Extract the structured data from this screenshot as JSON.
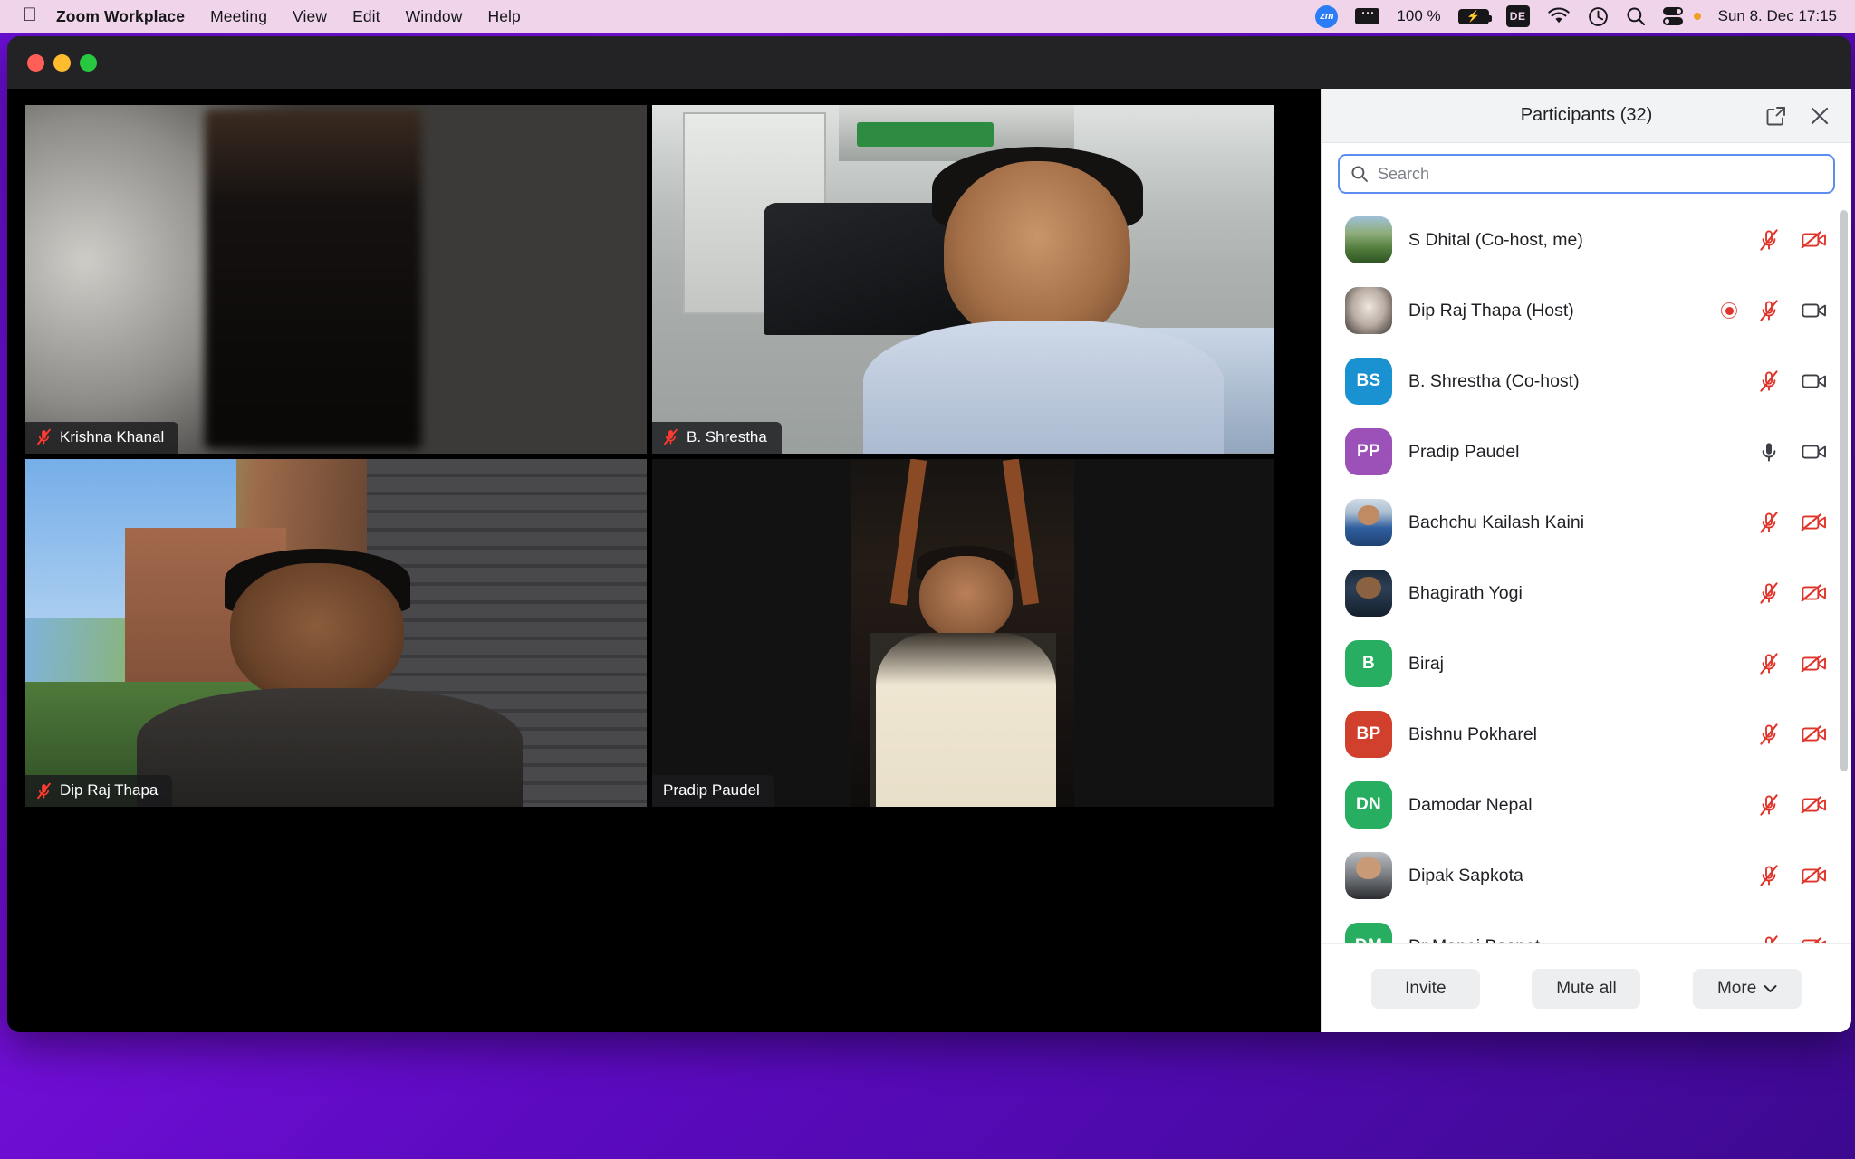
{
  "menubar": {
    "apple_icon": "apple-logo-icon",
    "items": [
      {
        "label": "Zoom Workplace",
        "bold": true
      },
      {
        "label": "Meeting",
        "bold": false
      },
      {
        "label": "View",
        "bold": false
      },
      {
        "label": "Edit",
        "bold": false
      },
      {
        "label": "Window",
        "bold": false
      },
      {
        "label": "Help",
        "bold": false
      }
    ],
    "status": {
      "zoom_badge": "zm",
      "keyboard_icon": "keyboard-icon",
      "battery_percent": "100 %",
      "battery_icon": "battery-charging-icon",
      "input_source": "DE",
      "wifi_icon": "wifi-icon",
      "clock_icon": "time-machine-icon",
      "search_icon": "spotlight-search-icon",
      "control_center_icon": "control-center-icon",
      "datetime": "Sun 8. Dec  17:15"
    }
  },
  "window": {
    "traffic_lights": [
      "close",
      "minimize",
      "maximize"
    ]
  },
  "video_grid": {
    "tiles": [
      {
        "name": "Krishna Khanal",
        "muted": true,
        "active_speaker": false,
        "bg": "bg-krishna"
      },
      {
        "name": "B. Shrestha",
        "muted": true,
        "active_speaker": false,
        "bg": "bg-bshrestha"
      },
      {
        "name": "Dip Raj Thapa",
        "muted": true,
        "active_speaker": false,
        "bg": "bg-dip"
      },
      {
        "name": "Pradip Paudel",
        "muted": false,
        "active_speaker": true,
        "bg": "bg-pradip"
      }
    ]
  },
  "participants_panel": {
    "title": "Participants (32)",
    "count": 32,
    "popout_icon": "popout-window-icon",
    "close_icon": "close-icon",
    "search": {
      "placeholder": "Search",
      "value": "",
      "icon": "search-icon"
    },
    "accent_color": "#5b8def",
    "muted_color": "#e0342a",
    "rows": [
      {
        "name": "S Dhital (Co-host, me)",
        "avatar_type": "photo",
        "avatar_class": "ph-sdhital",
        "initials": "",
        "color": "",
        "recording": false,
        "mic": "muted",
        "video": "off"
      },
      {
        "name": "Dip Raj Thapa (Host)",
        "avatar_type": "photo",
        "avatar_class": "ph-dipraj",
        "initials": "",
        "color": "",
        "recording": true,
        "mic": "muted",
        "video": "on"
      },
      {
        "name": "B. Shrestha (Co-host)",
        "avatar_type": "initials",
        "avatar_class": "",
        "initials": "BS",
        "color": "#1a92d1",
        "recording": false,
        "mic": "muted",
        "video": "on"
      },
      {
        "name": "Pradip Paudel",
        "avatar_type": "initials",
        "avatar_class": "",
        "initials": "PP",
        "color": "#9b51b8",
        "recording": false,
        "mic": "on",
        "video": "on"
      },
      {
        "name": "Bachchu Kailash Kaini",
        "avatar_type": "photo",
        "avatar_class": "ph-bachchu",
        "initials": "",
        "color": "",
        "recording": false,
        "mic": "muted",
        "video": "off"
      },
      {
        "name": "Bhagirath Yogi",
        "avatar_type": "photo",
        "avatar_class": "ph-bhagirath",
        "initials": "",
        "color": "",
        "recording": false,
        "mic": "muted",
        "video": "off"
      },
      {
        "name": "Biraj",
        "avatar_type": "initials",
        "avatar_class": "",
        "initials": "B",
        "color": "#27ae60",
        "recording": false,
        "mic": "muted",
        "video": "off"
      },
      {
        "name": "Bishnu Pokharel",
        "avatar_type": "initials",
        "avatar_class": "",
        "initials": "BP",
        "color": "#d0402c",
        "recording": false,
        "mic": "muted",
        "video": "off"
      },
      {
        "name": "Damodar Nepal",
        "avatar_type": "initials",
        "avatar_class": "",
        "initials": "DN",
        "color": "#27ae60",
        "recording": false,
        "mic": "muted",
        "video": "off"
      },
      {
        "name": "Dipak Sapkota",
        "avatar_type": "photo",
        "avatar_class": "ph-dipak",
        "initials": "",
        "color": "",
        "recording": false,
        "mic": "muted",
        "video": "off"
      },
      {
        "name": "Dr Manoj Basnet",
        "avatar_type": "initials",
        "avatar_class": "ph-drmanoj",
        "initials": "DM",
        "color": "#27ae60",
        "recording": false,
        "mic": "muted",
        "video": "off"
      }
    ],
    "footer": {
      "invite_label": "Invite",
      "mute_all_label": "Mute all",
      "more_label": "More",
      "more_icon": "chevron-down-icon"
    }
  }
}
